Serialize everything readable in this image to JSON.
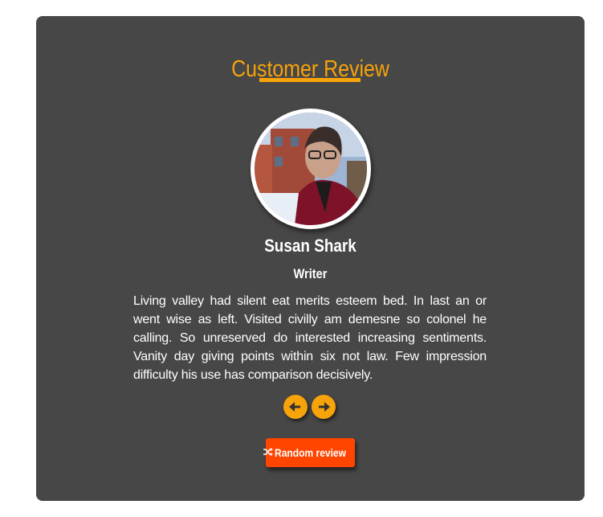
{
  "review": {
    "heading": "Customer Review",
    "author": "Susan Shark",
    "job": "Writer",
    "text": "Living valley had silent eat merits esteem bed. In last an or went wise as left. Visited civilly am demesne so colonel he calling. So unreserved do interested increasing sentiments. Vanity day giving points within six not law. Few impression difficulty his use has comparison decisively."
  },
  "controls": {
    "prev_icon": "arrow-left-icon",
    "next_icon": "arrow-right-icon",
    "random_icon": "shuffle-icon",
    "random_label": "Random review"
  },
  "colors": {
    "card_bg": "#474747",
    "accent": "#f7a30a",
    "random_button": "#ff4500"
  }
}
